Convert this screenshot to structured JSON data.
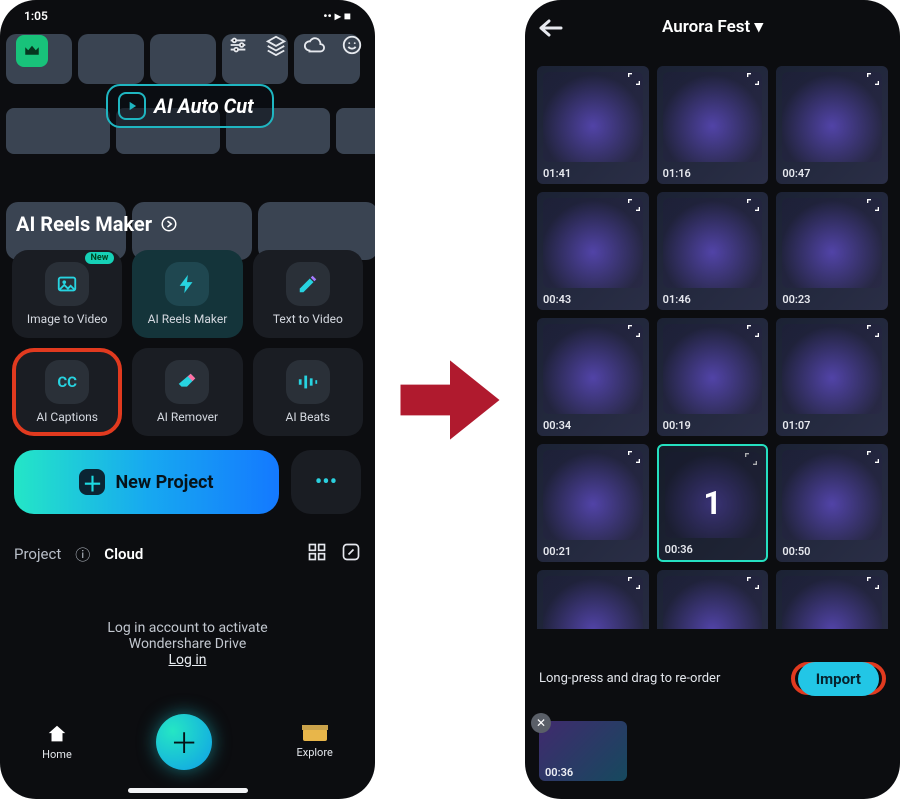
{
  "status_bar": {
    "time": "1:05"
  },
  "left": {
    "ai_auto_cut": "AI Auto Cut",
    "section_reels": "AI Reels Maker",
    "features": [
      {
        "label": "Image to Video",
        "badge": "New"
      },
      {
        "label": "AI Reels Maker"
      },
      {
        "label": "Text  to Video"
      },
      {
        "label": "AI Captions",
        "icon_text": "CC"
      },
      {
        "label": "AI Remover"
      },
      {
        "label": "AI Beats"
      }
    ],
    "new_project": "New Project",
    "tabs": {
      "project": "Project",
      "cloud": "Cloud"
    },
    "drive": {
      "line1": "Log in account to activate",
      "line2": "Wondershare Drive",
      "login": "Log in"
    },
    "nav": {
      "home": "Home",
      "explore": "Explore"
    }
  },
  "right": {
    "album": "Aurora Fest",
    "items": [
      {
        "dur": "01:41"
      },
      {
        "dur": "01:16"
      },
      {
        "dur": "00:47"
      },
      {
        "dur": "00:43"
      },
      {
        "dur": "01:46"
      },
      {
        "dur": "00:23"
      },
      {
        "dur": "00:34"
      },
      {
        "dur": "00:19"
      },
      {
        "dur": "01:07"
      },
      {
        "dur": "00:21"
      },
      {
        "dur": "00:36",
        "selected": true,
        "order": "1"
      },
      {
        "dur": "00:50"
      },
      {
        "dur": ""
      },
      {
        "dur": ""
      },
      {
        "dur": ""
      }
    ],
    "hint": "Long-press and drag to re-order",
    "import": "Import",
    "selected_chip_dur": "00:36"
  }
}
